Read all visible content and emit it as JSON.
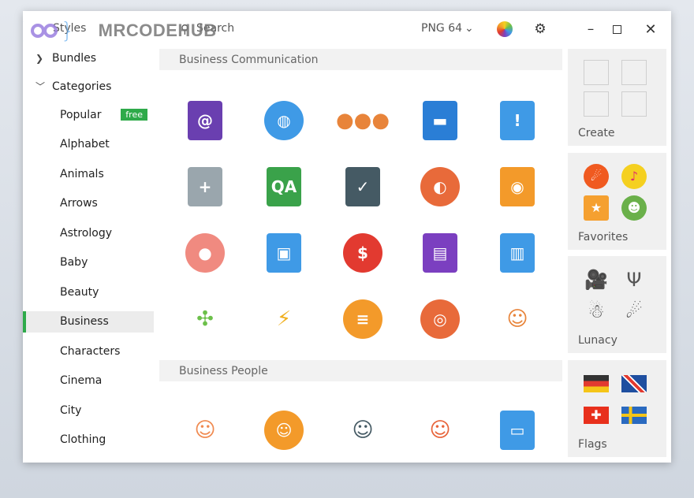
{
  "watermark": "MRCODEHUB",
  "titlebar": {
    "styles_label": "Styles",
    "search_placeholder": "Search",
    "format": "PNG 64"
  },
  "sidebar": {
    "top_items": [
      {
        "label": "Bundles",
        "chevron": "›"
      },
      {
        "label": "Categories",
        "chevron": "⌄"
      }
    ],
    "categories": [
      {
        "label": "Popular",
        "badge": "free"
      },
      {
        "label": "Alphabet"
      },
      {
        "label": "Animals"
      },
      {
        "label": "Arrows"
      },
      {
        "label": "Astrology"
      },
      {
        "label": "Baby"
      },
      {
        "label": "Beauty"
      },
      {
        "label": "Business",
        "selected": true
      },
      {
        "label": "Characters"
      },
      {
        "label": "Cinema"
      },
      {
        "label": "City"
      },
      {
        "label": "Clothing"
      }
    ]
  },
  "main": {
    "sections": [
      {
        "title": "Business Communication",
        "icons": [
          {
            "name": "email-at-icon",
            "color": "#6a3fb0",
            "glyph": "@",
            "shape": "rect"
          },
          {
            "name": "globe-cursor-icon",
            "color": "#3f9ae6",
            "glyph": "◍",
            "shape": "circle"
          },
          {
            "name": "team-icon",
            "color": "#e8843a",
            "glyph": "●●●",
            "shape": "none"
          },
          {
            "name": "shared-folder-icon",
            "color": "#2a7ed6",
            "glyph": "▬",
            "shape": "rect"
          },
          {
            "name": "important-document-icon",
            "color": "#3f9ae6",
            "glyph": "!",
            "shape": "rect"
          },
          {
            "name": "medical-mail-icon",
            "color": "#9aa6ad",
            "glyph": "+",
            "shape": "rect"
          },
          {
            "name": "qa-chat-icon",
            "color": "#3aa24a",
            "glyph": "QA",
            "shape": "rect"
          },
          {
            "name": "clipboard-check-icon",
            "color": "#455a64",
            "glyph": "✓",
            "shape": "rect"
          },
          {
            "name": "profile-circle-icon",
            "color": "#e86a3a",
            "glyph": "◐",
            "shape": "circle"
          },
          {
            "name": "padlock-icon",
            "color": "#f39a2a",
            "glyph": "◉",
            "shape": "rect"
          },
          {
            "name": "piggy-bank-icon",
            "color": "#f08a80",
            "glyph": "●",
            "shape": "circle"
          },
          {
            "name": "video-conference-icon",
            "color": "#3f9ae6",
            "glyph": "▣",
            "shape": "rect"
          },
          {
            "name": "no-money-search-icon",
            "color": "#e23a30",
            "glyph": "$",
            "shape": "circle"
          },
          {
            "name": "business-card-folder-icon",
            "color": "#7b3fc0",
            "glyph": "▤",
            "shape": "rect"
          },
          {
            "name": "office-badge-icon",
            "color": "#3f9ae6",
            "glyph": "▥",
            "shape": "rect"
          },
          {
            "name": "network-package-icon",
            "color": "#6cc04a",
            "glyph": "✣",
            "shape": "none"
          },
          {
            "name": "conflict-lightning-icon",
            "color": "#f0b020",
            "glyph": "⚡",
            "shape": "none"
          },
          {
            "name": "chat-bubbles-icon",
            "color": "#f39a2a",
            "glyph": "≡",
            "shape": "circle"
          },
          {
            "name": "target-icon",
            "color": "#e86a3a",
            "glyph": "◎",
            "shape": "circle"
          },
          {
            "name": "face-scan-icon",
            "color": "#e8843a",
            "glyph": "☺",
            "shape": "none"
          }
        ]
      },
      {
        "title": "Business People",
        "icons": [
          {
            "name": "businessman-icon",
            "color": "#f08a50",
            "glyph": "☺",
            "shape": "none"
          },
          {
            "name": "support-agent-icon",
            "color": "#f39a2a",
            "glyph": "☺",
            "shape": "circle"
          },
          {
            "name": "manager-icon",
            "color": "#455a64",
            "glyph": "☺",
            "shape": "none"
          },
          {
            "name": "businesswoman-icon",
            "color": "#e8643a",
            "glyph": "☺",
            "shape": "none"
          },
          {
            "name": "id-card-icon",
            "color": "#3f9ae6",
            "glyph": "▭",
            "shape": "rect"
          }
        ]
      }
    ]
  },
  "right_panel": {
    "cards": [
      {
        "label": "Create",
        "icons": [
          {
            "name": "empty-slot-icon",
            "glyph": "",
            "color": "#cfcfcf"
          },
          {
            "name": "empty-slot-icon",
            "glyph": "",
            "color": "#cfcfcf"
          },
          {
            "name": "empty-slot-icon",
            "glyph": "",
            "color": "#cfcfcf"
          },
          {
            "name": "empty-slot-icon",
            "glyph": "",
            "color": "#cfcfcf"
          }
        ]
      },
      {
        "label": "Favorites",
        "icons": [
          {
            "name": "comet-icon",
            "glyph": "☄",
            "color": "#f05a20"
          },
          {
            "name": "music-note-icon",
            "glyph": "♪",
            "color": "#f5d020"
          },
          {
            "name": "ticket-icon",
            "glyph": "★",
            "color": "#f5a030"
          },
          {
            "name": "ninja-turtle-icon",
            "glyph": "☻",
            "color": "#6ab04a"
          }
        ]
      },
      {
        "label": "Lunacy",
        "icons": [
          {
            "name": "movie-camera-icon",
            "glyph": "🎥",
            "color": "#555"
          },
          {
            "name": "cactus-icon",
            "glyph": "Ψ",
            "color": "#555"
          },
          {
            "name": "astronaut-icon",
            "glyph": "☃",
            "color": "#555"
          },
          {
            "name": "comet-outline-icon",
            "glyph": "☄",
            "color": "#555"
          }
        ]
      },
      {
        "label": "Flags",
        "icons": [
          {
            "name": "germany-flag-icon",
            "glyph": "",
            "color": "de"
          },
          {
            "name": "uk-flag-icon",
            "glyph": "",
            "color": "uk"
          },
          {
            "name": "switzerland-flag-icon",
            "glyph": "",
            "color": "ch"
          },
          {
            "name": "sweden-flag-icon",
            "glyph": "",
            "color": "se"
          }
        ]
      }
    ]
  },
  "colors": {
    "accent": "#2eaa4a",
    "selected_bg": "#ececec",
    "section_bg": "#f2f2f2",
    "card_bg": "#f0f0f0"
  }
}
